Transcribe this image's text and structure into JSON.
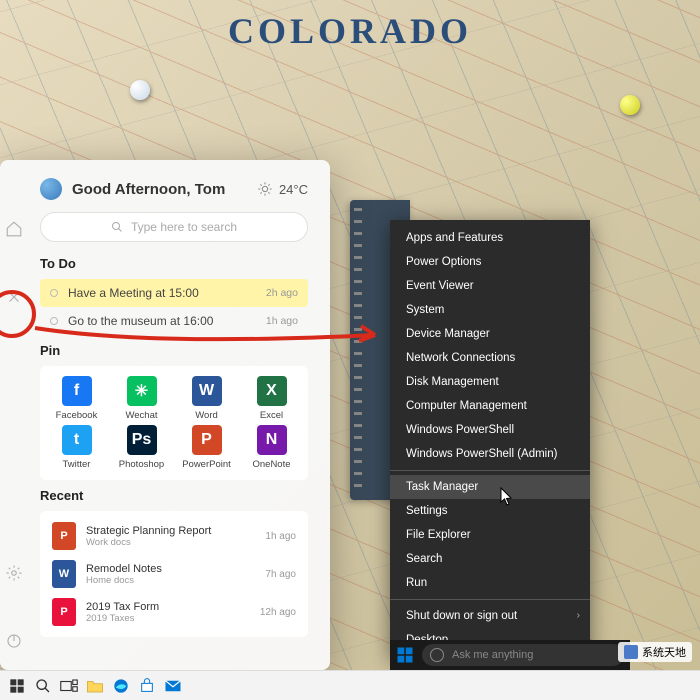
{
  "map": {
    "title": "COLORADO"
  },
  "panel": {
    "greeting": "Good Afternoon, Tom",
    "temperature": "24°C",
    "search_placeholder": "Type here to search",
    "todo_title": "To Do",
    "todos": [
      {
        "text": "Have a Meeting at 15:00",
        "time": "2h ago",
        "highlight": true
      },
      {
        "text": "Go to the museum at 16:00",
        "time": "1h ago",
        "highlight": false
      }
    ],
    "pin_title": "Pin",
    "pins": [
      {
        "label": "Facebook",
        "glyph": "f",
        "bg": "#1877f2"
      },
      {
        "label": "Wechat",
        "glyph": "✳",
        "bg": "#07c160"
      },
      {
        "label": "Word",
        "glyph": "W",
        "bg": "#2b579a"
      },
      {
        "label": "Excel",
        "glyph": "X",
        "bg": "#217346"
      },
      {
        "label": "Twitter",
        "glyph": "t",
        "bg": "#1da1f2"
      },
      {
        "label": "Photoshop",
        "glyph": "Ps",
        "bg": "#001e36"
      },
      {
        "label": "PowerPoint",
        "glyph": "P",
        "bg": "#d24726"
      },
      {
        "label": "OneNote",
        "glyph": "N",
        "bg": "#7719aa"
      }
    ],
    "recent_title": "Recent",
    "recents": [
      {
        "title": "Strategic Planning Report",
        "sub": "Work docs",
        "time": "1h ago",
        "glyph": "P",
        "bg": "#d24726"
      },
      {
        "title": "Remodel Notes",
        "sub": "Home docs",
        "time": "7h ago",
        "glyph": "W",
        "bg": "#2b579a"
      },
      {
        "title": "2019 Tax Form",
        "sub": "2019 Taxes",
        "time": "12h ago",
        "glyph": "P",
        "bg": "#e8123c"
      }
    ]
  },
  "context_menu": {
    "items": [
      "Apps and Features",
      "Power Options",
      "Event Viewer",
      "System",
      "Device Manager",
      "Network Connections",
      "Disk Management",
      "Computer Management",
      "Windows PowerShell",
      "Windows PowerShell (Admin)"
    ],
    "items2": [
      "Task Manager",
      "Settings",
      "File Explorer",
      "Search",
      "Run"
    ],
    "items3": [
      "Shut down or sign out",
      "Desktop"
    ],
    "highlighted": "Task Manager"
  },
  "mini_taskbar": {
    "search_placeholder": "Ask me anything"
  },
  "watermark": {
    "text": "系统天地"
  }
}
